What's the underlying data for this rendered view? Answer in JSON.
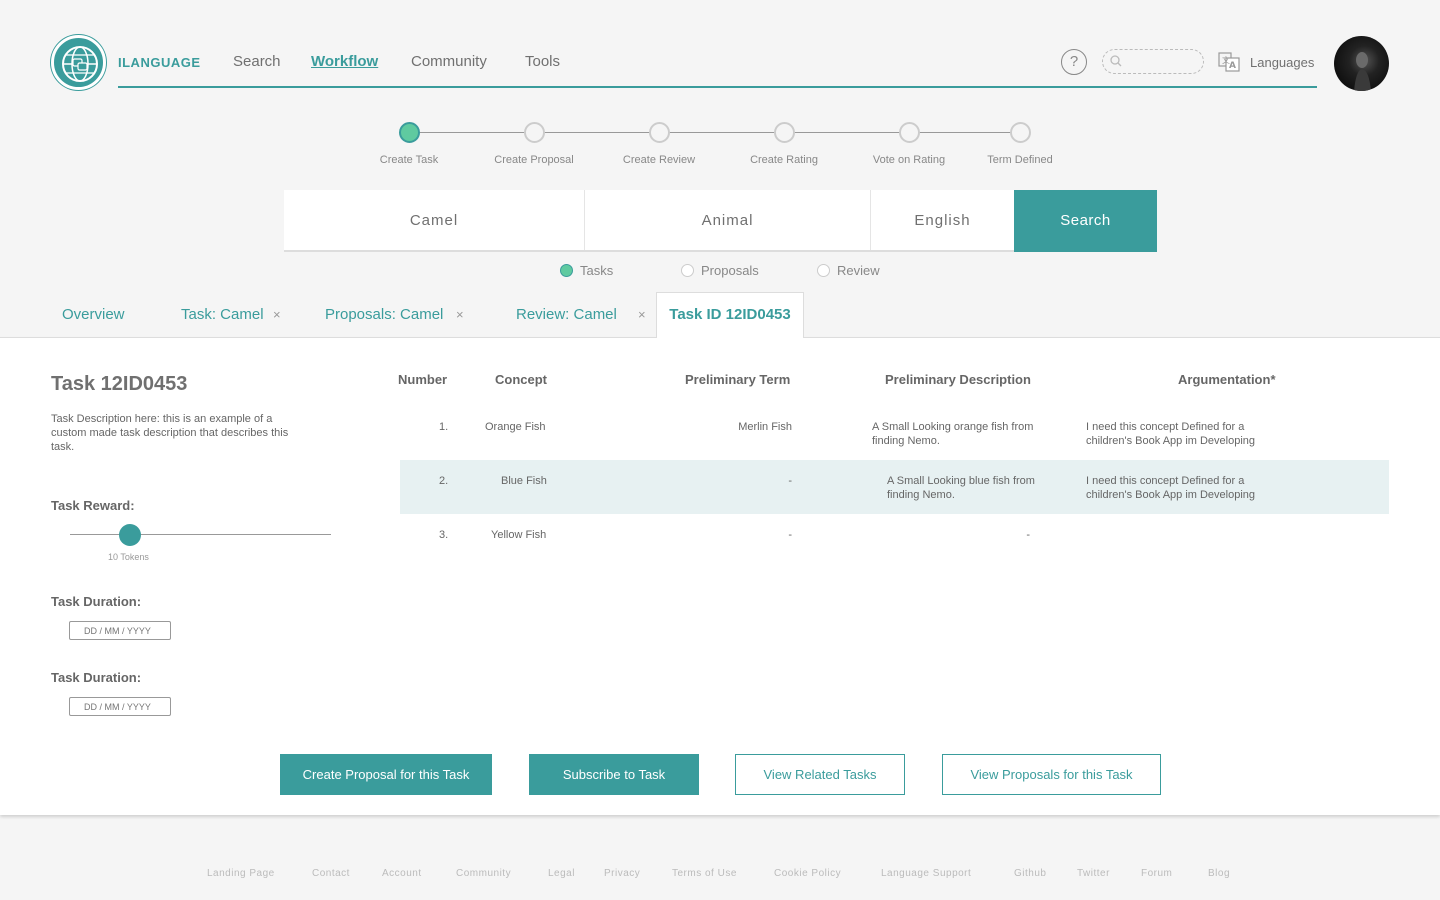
{
  "brand": "ILANGUAGE",
  "nav": [
    "Search",
    "Workflow",
    "Community",
    "Tools"
  ],
  "nav_active": "Workflow",
  "header": {
    "help": "?",
    "search_placeholder": "",
    "languages": "Languages"
  },
  "steps": [
    {
      "label": "Create Task",
      "done": true
    },
    {
      "label": "Create Proposal",
      "done": false
    },
    {
      "label": "Create Review",
      "done": false
    },
    {
      "label": "Create Rating",
      "done": false
    },
    {
      "label": "Vote on Rating",
      "done": false
    },
    {
      "label": "Term Defined",
      "done": false
    }
  ],
  "search": {
    "term": "Camel",
    "category": "Animal",
    "language": "English",
    "button": "Search"
  },
  "search_types": [
    {
      "label": "Tasks",
      "selected": true
    },
    {
      "label": "Proposals",
      "selected": false
    },
    {
      "label": "Review",
      "selected": false
    }
  ],
  "tabs": [
    {
      "label": "Overview",
      "closable": false
    },
    {
      "label": "Task: Camel",
      "closable": true
    },
    {
      "label": "Proposals: Camel",
      "closable": true
    },
    {
      "label": "Review: Camel",
      "closable": true
    },
    {
      "label": "Task ID 12ID0453",
      "closable": false,
      "active": true
    }
  ],
  "close_glyph": "×",
  "task": {
    "title": "Task 12ID0453",
    "description": "Task Description here: this is an example of a custom made task description that describes this task.",
    "reward_label": "Task Reward:",
    "reward_value": "10 Tokens",
    "duration_label": "Task Duration:",
    "duration_label_2": "Task Duration:",
    "date_placeholder": "DD / MM / YYYY"
  },
  "table": {
    "headers": [
      "Number",
      "Concept",
      "Preliminary Term",
      "Preliminary Description",
      "Argumentation*"
    ],
    "rows": [
      {
        "number": "1.",
        "concept": "Orange Fish",
        "term": "Merlin Fish",
        "description": "A Small Looking orange fish from finding Nemo.",
        "argumentation": "I need this concept Defined for a children's Book App im Developing",
        "highlighted": false
      },
      {
        "number": "2.",
        "concept": "Blue Fish",
        "term": "-",
        "description": "A Small Looking blue fish from finding Nemo.",
        "argumentation": "I need this concept Defined for a children's Book App im Developing",
        "highlighted": true
      },
      {
        "number": "3.",
        "concept": "Yellow Fish",
        "term": "-",
        "description": "-",
        "argumentation": "",
        "highlighted": false
      }
    ]
  },
  "actions": [
    "Create Proposal for this Task",
    "Subscribe to Task",
    "View Related Tasks",
    "View Proposals for this Task"
  ],
  "footer": [
    "Landing Page",
    "Contact",
    "Account",
    "Community",
    "Legal",
    "Privacy",
    "Terms of Use",
    "Cookie Policy",
    "Language Support",
    "Github",
    "Twitter",
    "Forum",
    "Blog"
  ],
  "colors": {
    "accent": "#3a9c9c",
    "step_done": "#5fcaa0",
    "row_highlight": "#e7f1f2"
  }
}
